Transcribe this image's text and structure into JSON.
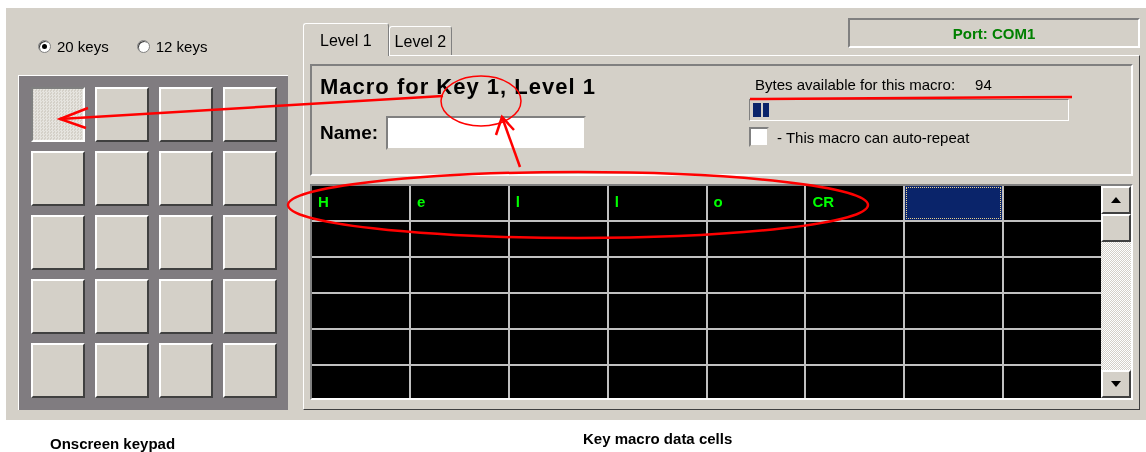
{
  "key_count_options": [
    {
      "label": "20 keys",
      "selected": true
    },
    {
      "label": "12 keys",
      "selected": false
    }
  ],
  "keypad": {
    "keys": [
      {
        "selected": true
      },
      {
        "selected": false
      },
      {
        "selected": false
      },
      {
        "selected": false
      },
      {
        "selected": false
      },
      {
        "selected": false
      },
      {
        "selected": false
      },
      {
        "selected": false
      },
      {
        "selected": false
      },
      {
        "selected": false
      },
      {
        "selected": false
      },
      {
        "selected": false
      },
      {
        "selected": false
      },
      {
        "selected": false
      },
      {
        "selected": false
      },
      {
        "selected": false
      },
      {
        "selected": false
      },
      {
        "selected": false
      },
      {
        "selected": false
      },
      {
        "selected": false
      }
    ]
  },
  "tabs": [
    {
      "label": "Level 1",
      "selected": true
    },
    {
      "label": "Level 2",
      "selected": false
    }
  ],
  "port_status": "Port: COM1",
  "macro": {
    "heading": "Macro for Key 1, Level 1",
    "name_label": "Name:",
    "bytes_label": "Bytes available for this macro:",
    "bytes_value": "94",
    "bytes_meter": {
      "level": 0.05
    },
    "auto_repeat": {
      "label": "- This macro can auto-repeat",
      "checked": false
    }
  },
  "cells": {
    "rows": [
      [
        {
          "text": "H",
          "selected": false
        },
        {
          "text": "e",
          "selected": false
        },
        {
          "text": "l",
          "selected": false
        },
        {
          "text": "l",
          "selected": false
        },
        {
          "text": "o",
          "selected": false
        },
        {
          "text": "CR",
          "selected": false
        },
        {
          "selected": true
        },
        {
          "selected": false
        }
      ],
      [
        {
          "selected": false
        },
        {
          "selected": false
        },
        {
          "selected": false
        },
        {
          "selected": false
        },
        {
          "selected": false
        },
        {
          "selected": false
        },
        {
          "selected": false
        },
        {
          "selected": false
        }
      ],
      [
        {
          "selected": false
        },
        {
          "selected": false
        },
        {
          "selected": false
        },
        {
          "selected": false
        },
        {
          "selected": false
        },
        {
          "selected": false
        },
        {
          "selected": false
        },
        {
          "selected": false
        }
      ],
      [
        {
          "selected": false
        },
        {
          "selected": false
        },
        {
          "selected": false
        },
        {
          "selected": false
        },
        {
          "selected": false
        },
        {
          "selected": false
        },
        {
          "selected": false
        },
        {
          "selected": false
        }
      ],
      [
        {
          "selected": false
        },
        {
          "selected": false
        },
        {
          "selected": false
        },
        {
          "selected": false
        },
        {
          "selected": false
        },
        {
          "selected": false
        },
        {
          "selected": false
        },
        {
          "selected": false
        }
      ],
      [
        {
          "selected": false
        },
        {
          "selected": false
        },
        {
          "selected": false
        },
        {
          "selected": false
        },
        {
          "selected": false
        },
        {
          "selected": false
        },
        {
          "selected": false
        },
        {
          "selected": false
        }
      ]
    ]
  },
  "captions": [
    "Onscreen keypad",
    "Key macro data cells"
  ]
}
